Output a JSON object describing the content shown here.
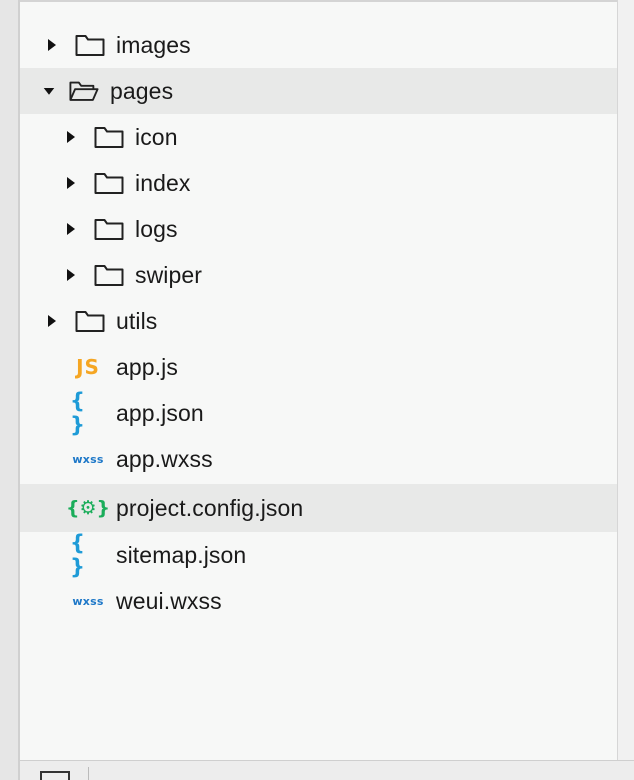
{
  "file_tree": {
    "items": [
      {
        "label": "images",
        "kind": "folder",
        "depth": 0,
        "expanded": false,
        "icon": "folder-icon"
      },
      {
        "label": "pages",
        "kind": "folder",
        "depth": 0,
        "expanded": true,
        "icon": "folder-open-icon"
      },
      {
        "label": "icon",
        "kind": "folder",
        "depth": 1,
        "expanded": false,
        "icon": "folder-icon"
      },
      {
        "label": "index",
        "kind": "folder",
        "depth": 1,
        "expanded": false,
        "icon": "folder-icon"
      },
      {
        "label": "logs",
        "kind": "folder",
        "depth": 1,
        "expanded": false,
        "icon": "folder-icon"
      },
      {
        "label": "swiper",
        "kind": "folder",
        "depth": 1,
        "expanded": false,
        "icon": "folder-icon"
      },
      {
        "label": "utils",
        "kind": "folder",
        "depth": 0,
        "expanded": false,
        "icon": "folder-icon"
      },
      {
        "label": "app.js",
        "kind": "file",
        "icon": "js-file-icon",
        "badge": "JS"
      },
      {
        "label": "app.json",
        "kind": "file",
        "icon": "json-file-icon",
        "badge": "{ }"
      },
      {
        "label": "app.wxss",
        "kind": "file",
        "icon": "wxss-file-icon",
        "badge": "wxss"
      },
      {
        "label": "project.config.json",
        "kind": "file",
        "icon": "config-file-icon",
        "badge": "{⚙}"
      },
      {
        "label": "sitemap.json",
        "kind": "file",
        "icon": "json-file-icon",
        "badge": "{ }"
      },
      {
        "label": "weui.wxss",
        "kind": "file",
        "icon": "wxss-file-icon",
        "badge": "wxss"
      }
    ]
  },
  "colors": {
    "js": "#f5a623",
    "json": "#1e9bd7",
    "wxss": "#1e78c8",
    "config": "#1aad5a",
    "row_highlight": "#e8e9e8"
  }
}
